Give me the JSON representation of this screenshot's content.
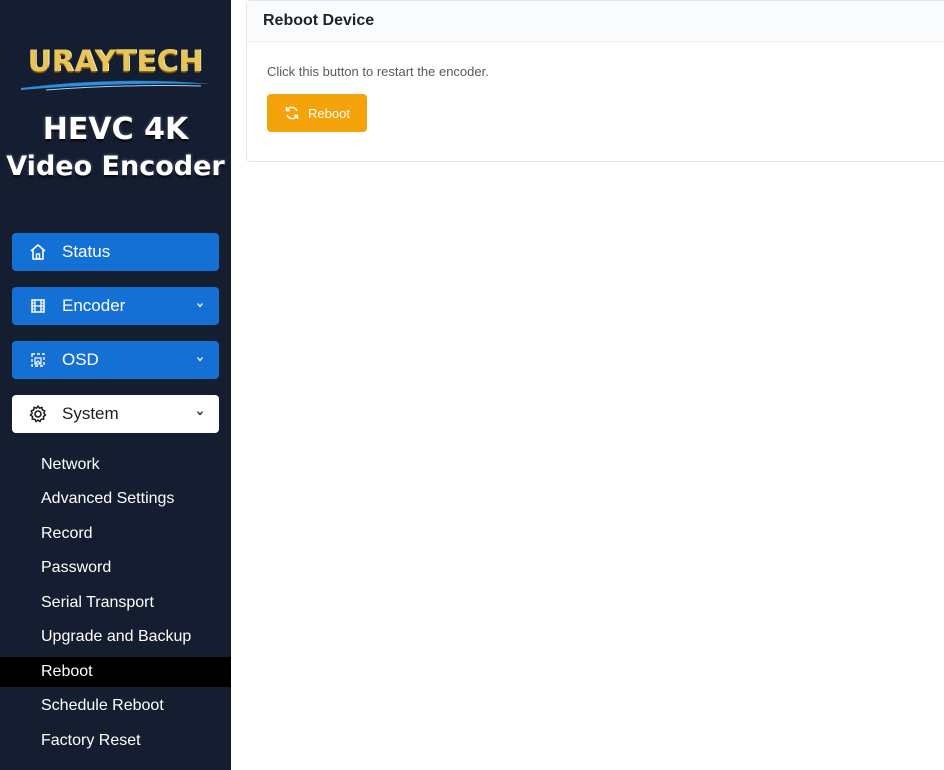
{
  "brand": {
    "logo": "URAYTECH",
    "product_line1": "HEVC 4K",
    "product_line2": "Video Encoder"
  },
  "sidebar": {
    "menu": [
      {
        "label": "Status",
        "icon": "home-icon",
        "expandable": false
      },
      {
        "label": "Encoder",
        "icon": "film-icon",
        "expandable": true
      },
      {
        "label": "OSD",
        "icon": "image-frame-icon",
        "expandable": true
      },
      {
        "label": "System",
        "icon": "gear-icon",
        "expandable": true,
        "expanded": true
      }
    ],
    "system_items": [
      "Network",
      "Advanced Settings",
      "Record",
      "Password",
      "Serial Transport",
      "Upgrade and Backup",
      "Reboot",
      "Schedule Reboot",
      "Factory Reset"
    ],
    "active_item": "Reboot"
  },
  "main": {
    "card_title": "Reboot Device",
    "description": "Click this button to restart the encoder.",
    "reboot_button": {
      "label": "Reboot",
      "icon": "refresh-icon"
    }
  },
  "colors": {
    "sidebar_bg": "#151d30",
    "nav_blue": "#1570d6",
    "reboot_orange": "#f5a30a",
    "active_bg": "#000000"
  }
}
